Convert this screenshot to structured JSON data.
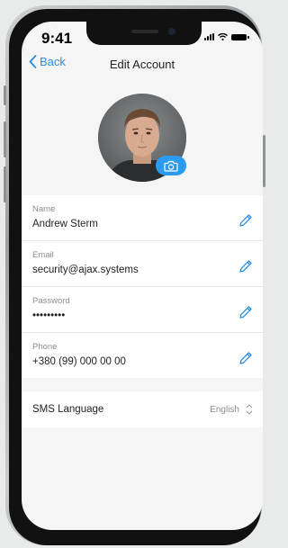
{
  "status_bar": {
    "time": "9:41"
  },
  "nav": {
    "back_label": "Back",
    "title": "Edit Account"
  },
  "profile": {
    "avatar_alt": "Profile photo"
  },
  "fields": [
    {
      "label": "Name",
      "value": "Andrew Sterm"
    },
    {
      "label": "Email",
      "value": "security@ajax.systems"
    },
    {
      "label": "Password",
      "value": "•••••••••"
    },
    {
      "label": "Phone",
      "value": "+380 (99) 000 00 00"
    }
  ],
  "sms_language": {
    "label": "SMS Language",
    "value": "English"
  },
  "colors": {
    "accent": "#2a8ee6",
    "background": "#f5f5f5"
  },
  "icons": [
    "chevron-left-icon",
    "camera-icon",
    "pencil-icon",
    "chevron-up-down-icon",
    "signal-icon",
    "wifi-icon",
    "battery-icon"
  ]
}
